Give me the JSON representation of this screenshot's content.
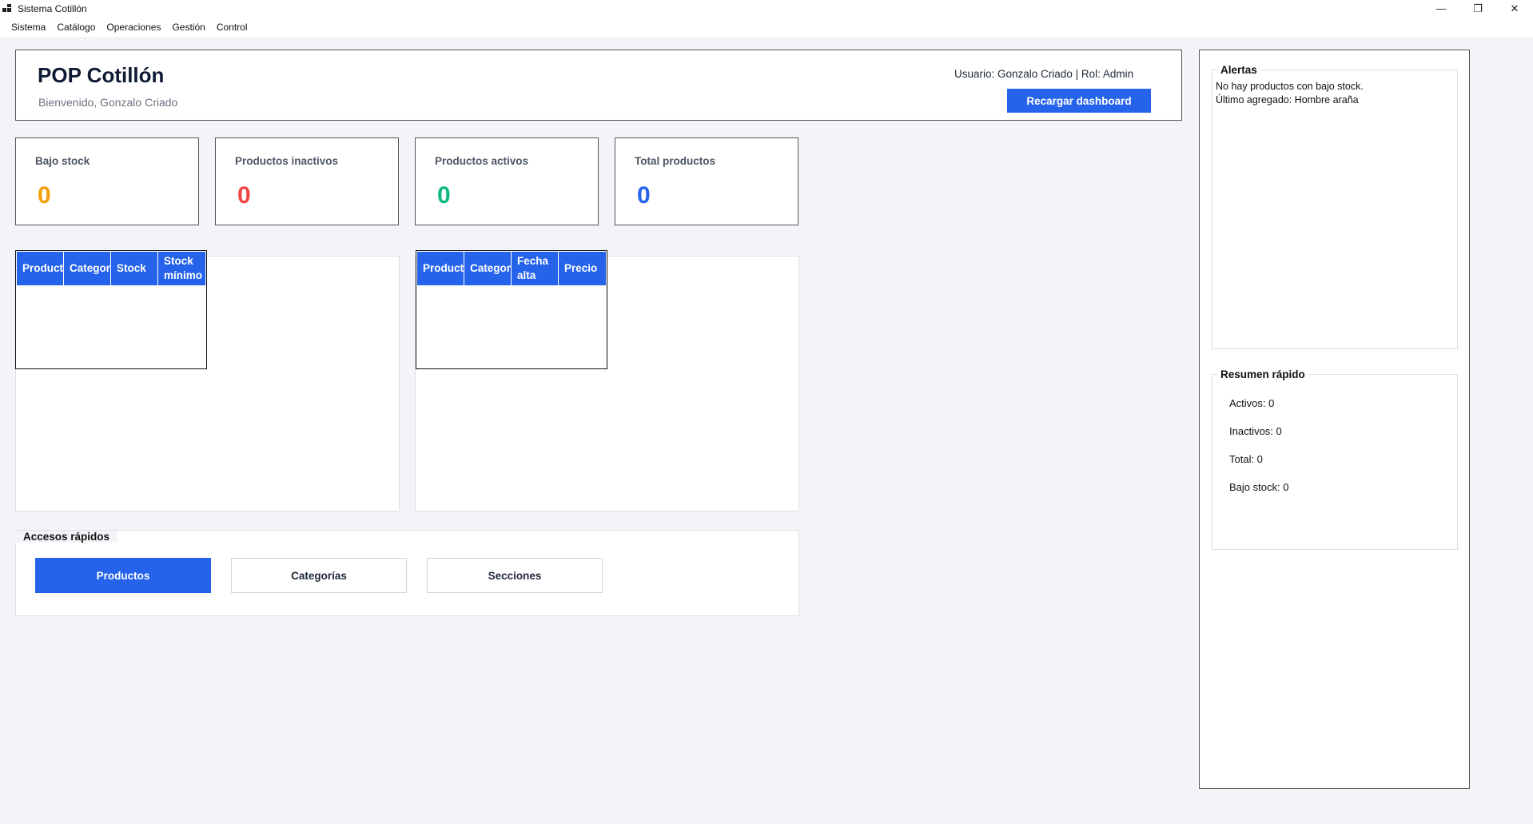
{
  "window": {
    "title": "Sistema Cotillón",
    "controls": {
      "minimize": "—",
      "restore": "❐",
      "close": "✕"
    }
  },
  "menu": [
    "Sistema",
    "Catálogo",
    "Operaciones",
    "Gestión",
    "Control"
  ],
  "header": {
    "brand": "POP Cotillón",
    "welcome": "Bienvenido, Gonzalo Criado",
    "user_info": "Usuario: Gonzalo Criado | Rol: Admin",
    "reload_label": "Recargar dashboard"
  },
  "stats": [
    {
      "label": "Bajo stock",
      "value": "0",
      "color": "#f59e0b"
    },
    {
      "label": "Productos inactivos",
      "value": "0",
      "color": "#ef4444"
    },
    {
      "label": "Productos activos",
      "value": "0",
      "color": "#10b981"
    },
    {
      "label": "Total productos",
      "value": "0",
      "color": "#2563eb"
    }
  ],
  "low_stock_grid": {
    "columns": [
      "Producto",
      "Categoría",
      "Stock",
      "Stock mínimo"
    ],
    "rows": []
  },
  "recent_grid": {
    "columns": [
      "Producto",
      "Categoría",
      "Fecha alta",
      "Precio"
    ],
    "rows": []
  },
  "quick_access": {
    "title": "Accesos rápidos",
    "buttons": [
      "Productos",
      "Categorías",
      "Secciones"
    ]
  },
  "alerts": {
    "title": "Alertas",
    "lines": [
      "No hay productos con bajo stock.",
      "Último agregado: Hombre araña"
    ]
  },
  "summary": {
    "title": "Resumen rápido",
    "lines": [
      "Activos: 0",
      "Inactivos: 0",
      "Total: 0",
      "Bajo stock: 0"
    ]
  },
  "colors": {
    "accent": "#2563eb",
    "background": "#f3f4f8"
  }
}
